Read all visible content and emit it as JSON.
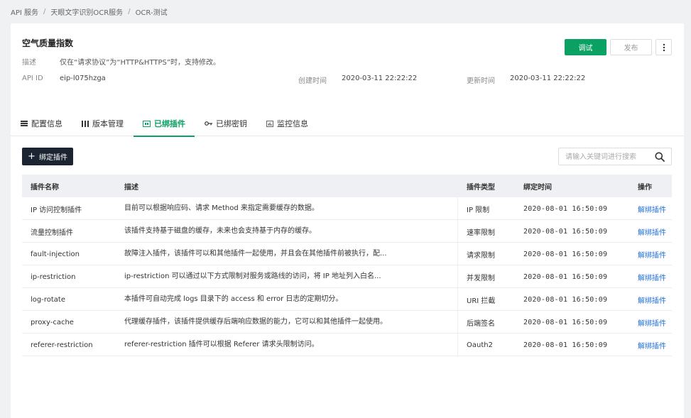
{
  "breadcrumb": [
    "API 服务",
    "天眼文字识别OCR服务",
    "OCR-测试"
  ],
  "api": {
    "title": "空气质量指数",
    "desc_label": "描述",
    "desc_value": "仅在“请求协议”为“HTTP&HTTPS”时，支持修改。",
    "id_label": "API ID",
    "id_value": "eip-l075hzga",
    "created_label": "创建时间",
    "created_value": "2020-03-11 22:22:22",
    "updated_label": "更新时间",
    "updated_value": "2020-03-11 22:22:22"
  },
  "actions": {
    "debug_label": "调试",
    "publish_label": "发布"
  },
  "tabs": [
    {
      "label": "配置信息",
      "icon": "config-list-icon",
      "active": false
    },
    {
      "label": "版本管理",
      "icon": "version-bars-icon",
      "active": false
    },
    {
      "label": "已绑插件",
      "icon": "plugin-icon",
      "active": true
    },
    {
      "label": "已绑密钥",
      "icon": "key-icon",
      "active": false
    },
    {
      "label": "监控信息",
      "icon": "monitor-chart-icon",
      "active": false
    }
  ],
  "toolbar": {
    "bind_label": "绑定插件",
    "search_placeholder": "请输入关键词进行搜索"
  },
  "table": {
    "headers": [
      "插件名称",
      "描述",
      "插件类型",
      "绑定时间",
      "操作"
    ],
    "rows": [
      {
        "name": "IP 访问控制插件",
        "desc": "目前可以根据响应码、请求 Method 来指定需要缓存的数据。",
        "type": "IP 限制",
        "time": "2020-08-01 16:50:09",
        "action": "解绑插件"
      },
      {
        "name": "流量控制插件",
        "desc": "该插件支持基于磁盘的缓存，未来也会支持基于内存的缓存。",
        "type": "速率限制",
        "time": "2020-08-01 16:50:09",
        "action": "解绑插件"
      },
      {
        "name": "fault-injection",
        "desc": "故障注入插件，该插件可以和其他插件一起使用，并且会在其他插件前被执行，配...",
        "type": "请求限制",
        "time": "2020-08-01 16:50:09",
        "action": "解绑插件"
      },
      {
        "name": "ip-restriction",
        "desc": "ip-restriction 可以通过以下方式限制对服务或路线的访问，将 IP 地址列入白名...",
        "type": "并发限制",
        "time": "2020-08-01 16:50:09",
        "action": "解绑插件"
      },
      {
        "name": "log-rotate",
        "desc": "本插件可自动完成 logs 目录下的 access 和 error 日志的定期切分。",
        "type": "URI 拦截",
        "time": "2020-08-01 16:50:09",
        "action": "解绑插件"
      },
      {
        "name": "proxy-cache",
        "desc": "代理缓存插件，该插件提供缓存后端响应数据的能力，它可以和其他插件一起使用。",
        "type": "后端签名",
        "time": "2020-08-01 16:50:09",
        "action": "解绑插件"
      },
      {
        "name": "referer-restriction",
        "desc": "referer-restriction 插件可以根据 Referer 请求头限制访问。",
        "type": "Oauth2",
        "time": "2020-08-01 16:50:09",
        "action": "解绑插件"
      }
    ]
  },
  "colors": {
    "accent": "#0aa163",
    "link": "#1e6fd9",
    "dark_button": "#1b2430"
  }
}
